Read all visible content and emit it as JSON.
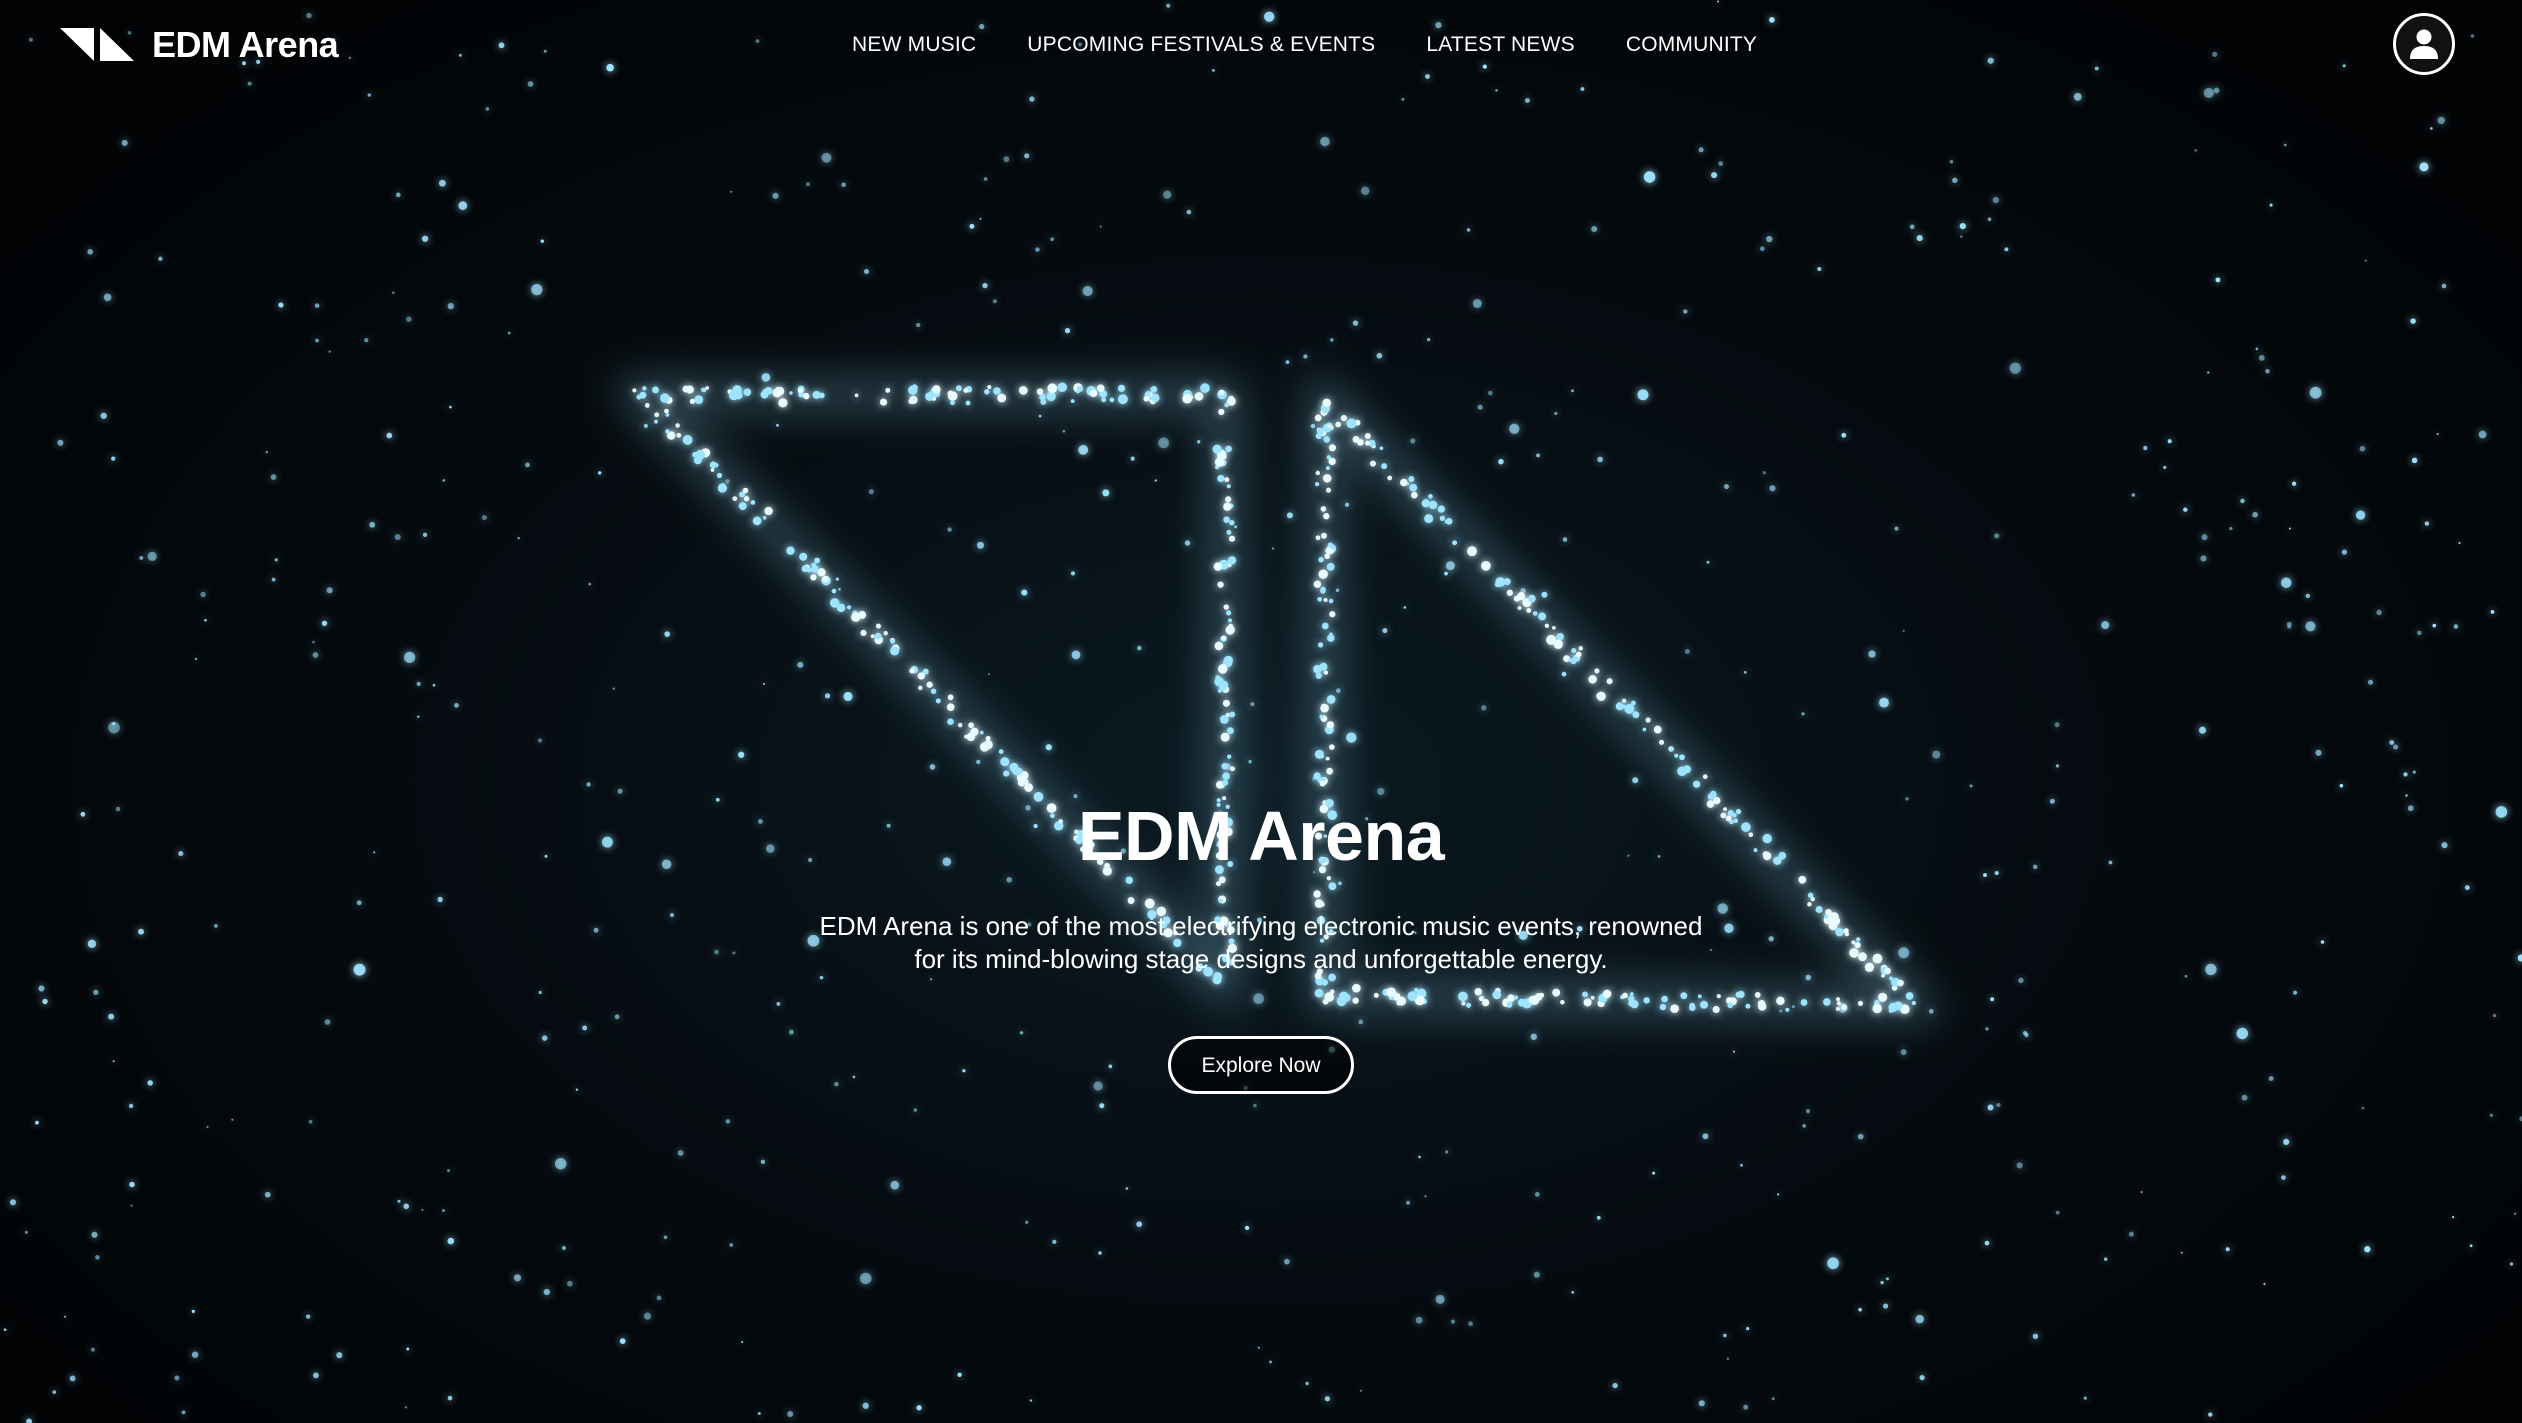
{
  "header": {
    "brand_name": "EDM Arena",
    "nav": [
      {
        "label": "NEW MUSIC"
      },
      {
        "label": "UPCOMING FESTIVALS & EVENTS"
      },
      {
        "label": "LATEST NEWS"
      },
      {
        "label": "COMMUNITY"
      }
    ],
    "account_icon": "user-icon"
  },
  "hero": {
    "title": "EDM Arena",
    "description": "EDM Arena is one of the most electrifying electronic music events, renowned for its mind-blowing stage designs and unforgettable energy.",
    "cta_label": "Explore Now"
  },
  "colors": {
    "background": "#020608",
    "particle": "#9fe4ff",
    "text": "#ffffff"
  }
}
